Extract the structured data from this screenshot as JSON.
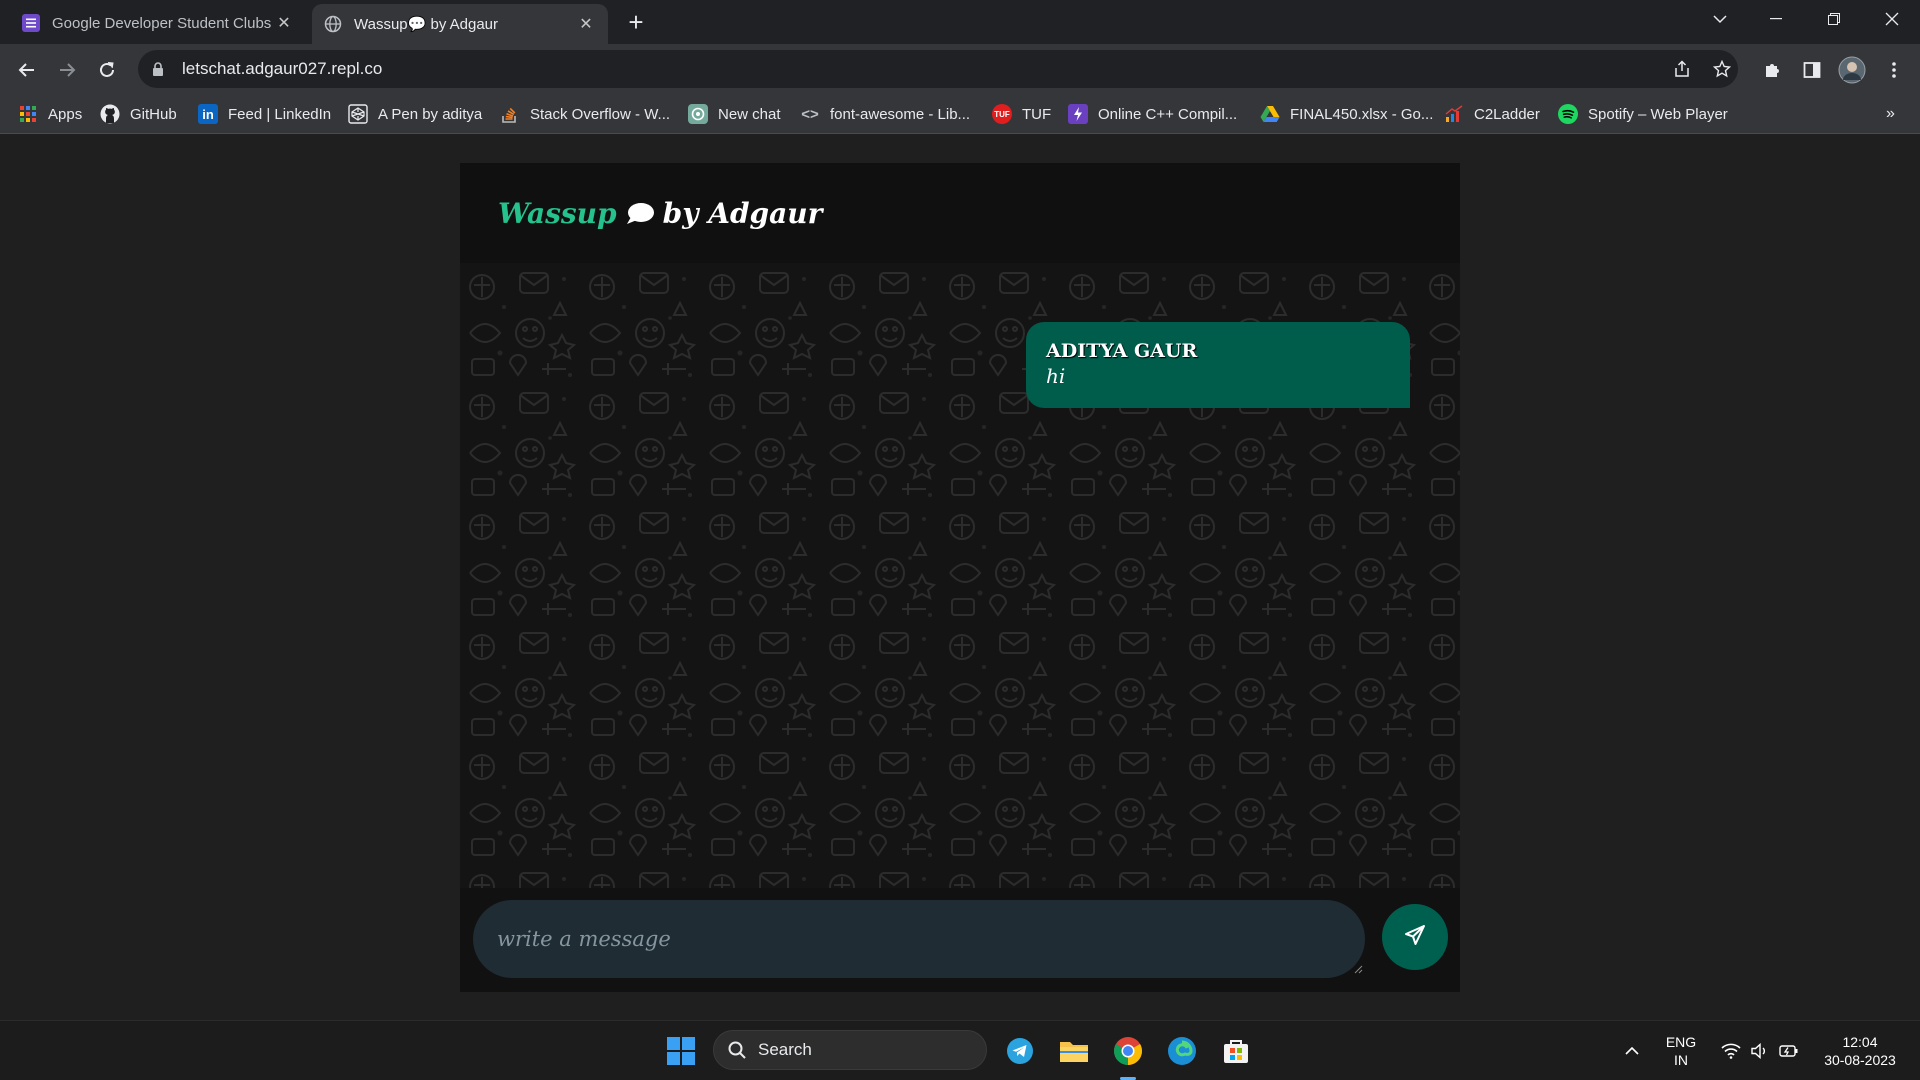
{
  "browser": {
    "tabs": [
      {
        "title": "Google Developer Student Clubs",
        "active": false
      },
      {
        "title": "Wassup💬 by Adgaur",
        "active": true
      }
    ],
    "url": "letschat.adgaur027.repl.co",
    "bookmarks": [
      {
        "label": "Apps",
        "icon": "apps-grid-icon"
      },
      {
        "label": "GitHub",
        "icon": "github-icon"
      },
      {
        "label": "Feed | LinkedIn",
        "icon": "linkedin-icon"
      },
      {
        "label": "A Pen by aditya",
        "icon": "codepen-icon"
      },
      {
        "label": "Stack Overflow - W...",
        "icon": "stackoverflow-icon"
      },
      {
        "label": "New chat",
        "icon": "chatgpt-icon"
      },
      {
        "label": "font-awesome - Lib...",
        "icon": "code-brackets-icon"
      },
      {
        "label": "TUF",
        "icon": "tuf-icon"
      },
      {
        "label": "Online C++ Compil...",
        "icon": "compiler-icon"
      },
      {
        "label": "FINAL450.xlsx - Go...",
        "icon": "google-drive-icon"
      },
      {
        "label": "C2Ladder",
        "icon": "c2ladder-icon"
      },
      {
        "label": "Spotify – Web Player",
        "icon": "spotify-icon"
      }
    ],
    "more_bookmarks": "»"
  },
  "app": {
    "brand_primary": "Wassup",
    "brand_secondary": "by Adgaur",
    "accent_color": "#25c28e",
    "messages": [
      {
        "sender": "ADITYA GAUR",
        "text": "hi"
      }
    ],
    "input_placeholder": "write a message"
  },
  "taskbar": {
    "search_label": "Search",
    "language_top": "ENG",
    "language_bottom": "IN",
    "time": "12:04",
    "date": "30-08-2023"
  }
}
